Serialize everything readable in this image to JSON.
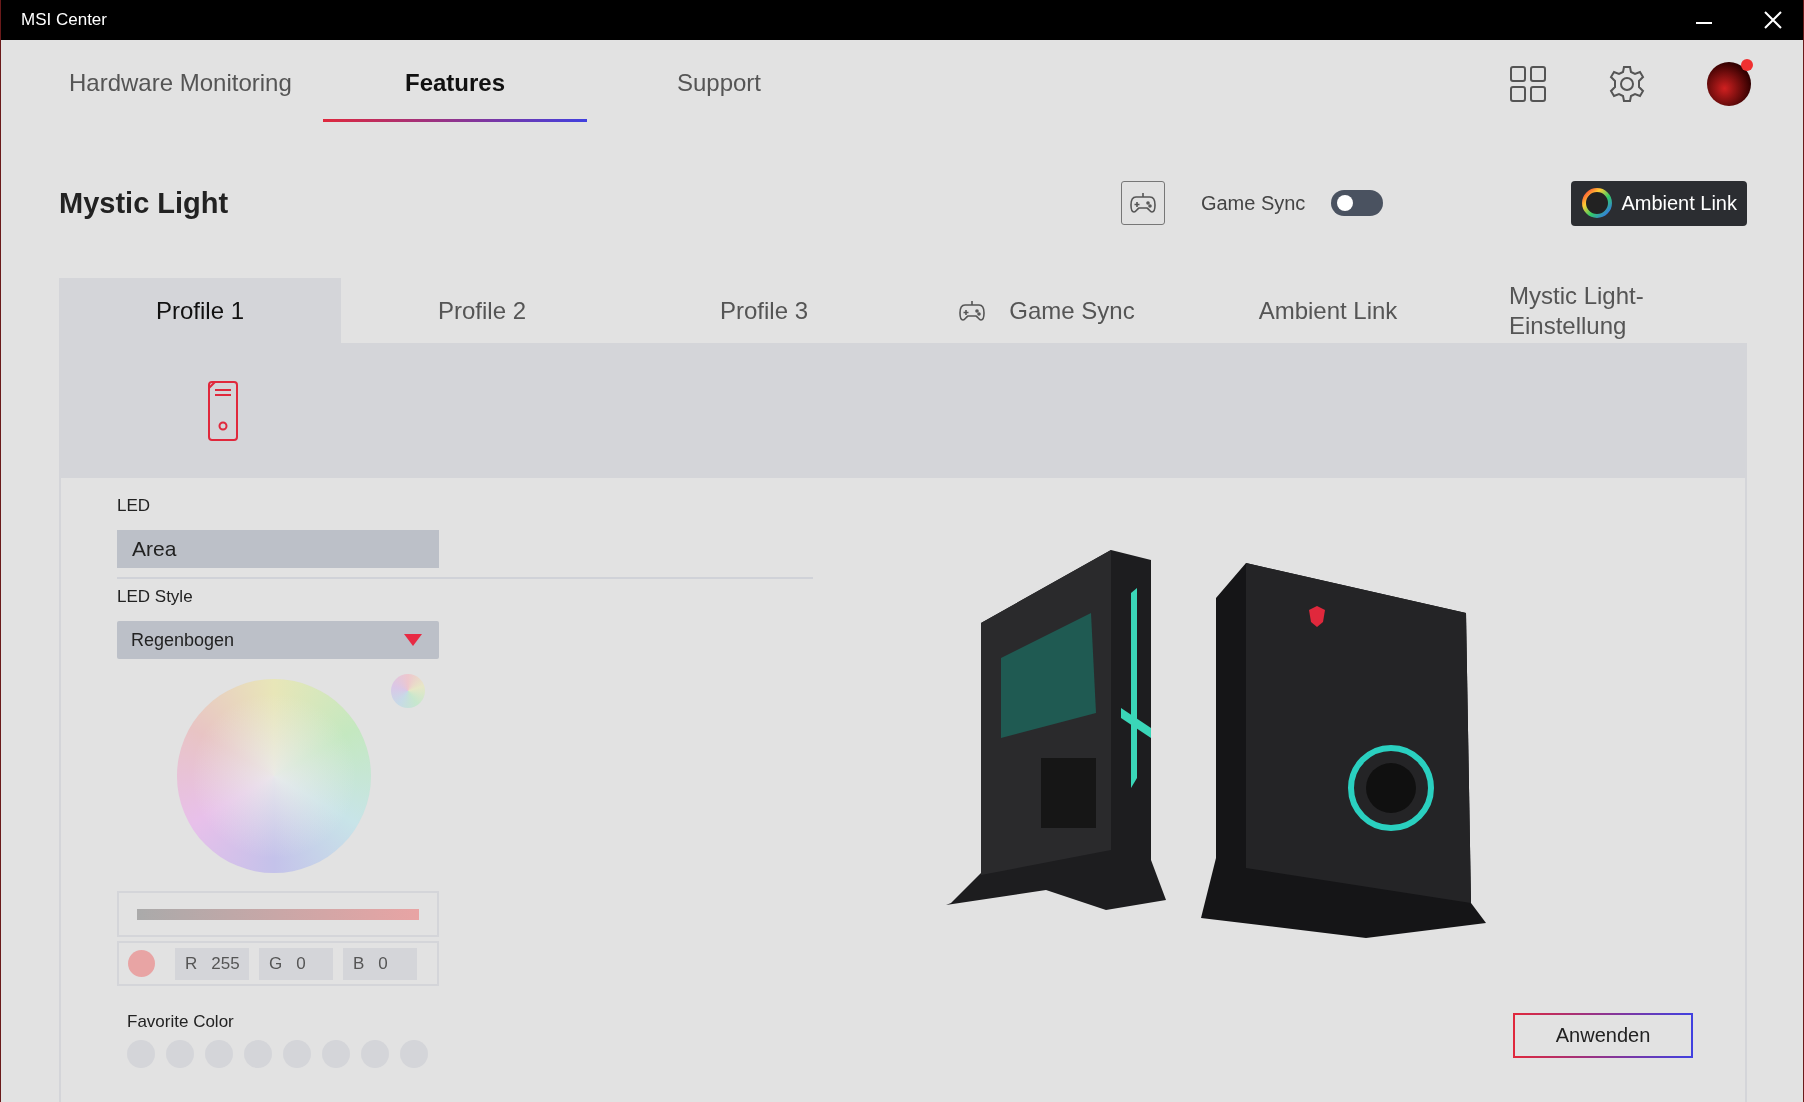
{
  "window": {
    "title": "MSI Center"
  },
  "nav_tabs": [
    {
      "label": "Hardware Monitoring",
      "selected": false
    },
    {
      "label": "Features",
      "selected": true
    },
    {
      "label": "Support",
      "selected": false
    }
  ],
  "account": {
    "notification": true
  },
  "header": {
    "title": "Mystic Light",
    "game_sync": {
      "label": "Game Sync",
      "on": false
    },
    "ambient_link_button": "Ambient Link"
  },
  "profile_tabs": [
    {
      "label": "Profile 1",
      "kind": "text",
      "selected": true
    },
    {
      "label": "Profile 2",
      "kind": "text",
      "selected": false
    },
    {
      "label": "Profile 3",
      "kind": "text",
      "selected": false
    },
    {
      "label": "Game Sync",
      "kind": "icon",
      "selected": false
    },
    {
      "label": "Ambient Link",
      "kind": "text",
      "selected": false
    },
    {
      "label": "Mystic Light-Einstellung",
      "kind": "text",
      "selected": false
    }
  ],
  "devices": [
    {
      "selected": true
    }
  ],
  "led": {
    "label": "LED",
    "value": "Area"
  },
  "led_style": {
    "label": "LED Style",
    "value": "Regenbogen"
  },
  "brightness": {
    "level": 1
  },
  "rgb": [
    {
      "label": "R",
      "value": "255"
    },
    {
      "label": "G",
      "value": "0"
    },
    {
      "label": "B",
      "value": "0"
    }
  ],
  "favorite_color": {
    "label": "Favorite Color",
    "slots": [
      {
        "filled": false
      },
      {
        "filled": false
      },
      {
        "filled": false
      },
      {
        "filled": false
      },
      {
        "filled": false
      },
      {
        "filled": false
      },
      {
        "filled": false
      },
      {
        "filled": false
      }
    ]
  },
  "apply_button": "Anwenden"
}
